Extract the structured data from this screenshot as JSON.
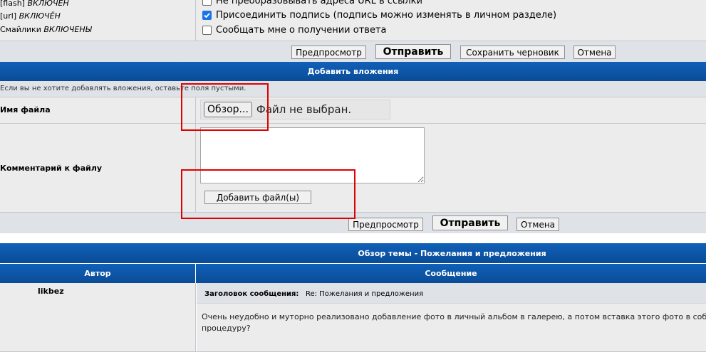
{
  "bbcode_status": [
    {
      "tag": "[flash]",
      "status": "ВКЛЮЧЁН"
    },
    {
      "tag": "[url]",
      "status": "ВКЛЮЧЁН"
    },
    {
      "tag": "Смайлики",
      "status": "ВКЛЮЧЕНЫ"
    }
  ],
  "options": [
    {
      "label": "Не преобразовывать адреса URL в ссылки",
      "checked": false
    },
    {
      "label": "Присоединить подпись (подпись можно изменять в личном разделе)",
      "checked": true
    },
    {
      "label": "Сообщать мне о получении ответа",
      "checked": false
    }
  ],
  "actions_top": {
    "preview": "Предпросмотр",
    "submit": "Отправить",
    "save_draft": "Сохранить черновик",
    "cancel": "Отмена"
  },
  "attachments": {
    "title": "Добавить вложения",
    "hint": "Если вы не хотите добавлять вложения, оставьте поля пустыми.",
    "filename_label": "Имя файла",
    "browse_button": "Обзор...",
    "no_file": "Файл не выбран.",
    "comment_label": "Комментарий к файлу",
    "add_files_button": "Добавить файл(ы)"
  },
  "actions_bottom": {
    "preview": "Предпросмотр",
    "submit": "Отправить",
    "cancel": "Отмена"
  },
  "topic_review": {
    "title": "Обзор темы - Пожелания и предложения",
    "col_author": "Автор",
    "col_message": "Сообщение",
    "post": {
      "author": "likbez",
      "subject_label": "Заголовок сообщения:",
      "subject": "Re: Пожелания и предложения",
      "body_line1": "Очень неудобно и муторно реализовано добавление фото в личный альбом в галерею, а потом вставка этого фото в собстве",
      "body_line2": "процедуру?"
    }
  },
  "colors": {
    "header_blue": "#0a4c97",
    "annotation_red": "#e00000"
  }
}
